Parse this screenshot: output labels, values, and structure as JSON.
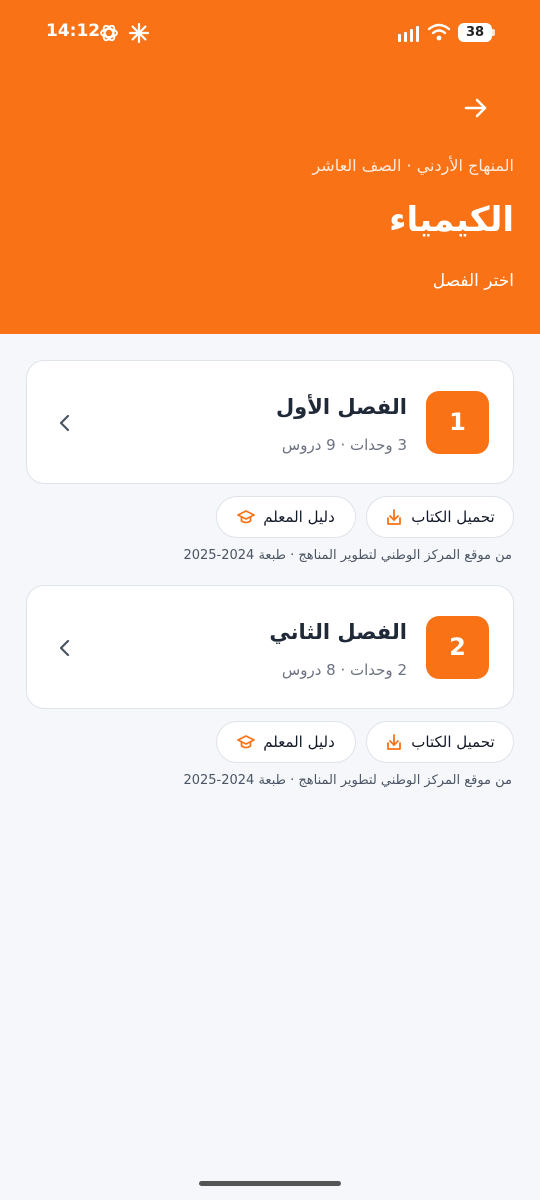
{
  "status": {
    "time": "14:12",
    "battery": "38",
    "icons": [
      "openai-icon",
      "sparkle-icon",
      "signal-icon",
      "wifi-icon",
      "battery-icon"
    ]
  },
  "header": {
    "back_icon": "arrow-right-icon",
    "subtitle": "المنهاج الأردني · الصف العاشر",
    "title": "الكيمياء",
    "prompt": "اختر الفصل"
  },
  "colors": {
    "accent": "#f97316",
    "background": "#f5f7fb",
    "card_border": "#dfe3ea"
  },
  "chapters": [
    {
      "number": "1",
      "title": "الفصل الأول",
      "meta": "3 وحدات · 9 دروس",
      "download_label": "تحميل الكتاب",
      "guide_label": "دليل المعلم",
      "source": "من موقع المركز الوطني لتطوير المناهج · طبعة 2024-2025"
    },
    {
      "number": "2",
      "title": "الفصل الثاني",
      "meta": "2 وحدات · 8 دروس",
      "download_label": "تحميل الكتاب",
      "guide_label": "دليل المعلم",
      "source": "من موقع المركز الوطني لتطوير المناهج · طبعة 2024-2025"
    }
  ]
}
